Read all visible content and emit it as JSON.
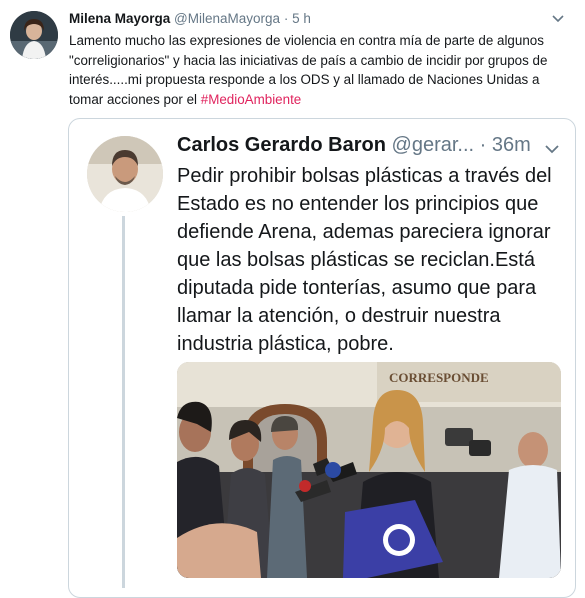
{
  "tweet": {
    "author_name": "Milena Mayorga",
    "author_handle": "@MilenaMayorga",
    "separator": "·",
    "time": "5 h",
    "text_main": "Lamento mucho las expresiones de violencia en contra mía de parte de algunos \"correligionarios\" y hacia las iniciativas de país a cambio de incidir por grupos de interés.....mi propuesta responde a los ODS y al llamado de Naciones Unidas a tomar acciones por el ",
    "hashtag": "#MedioAmbiente"
  },
  "quoted": {
    "author_name": "Carlos Gerardo Baron",
    "author_handle": "@gerar...",
    "separator": "·",
    "time": "36m",
    "text": "Pedir prohibir bolsas plásticas a través del Estado es no entender los principios que defiende Arena, ademas pareciera ignorar que las bolsas plásticas se reciclan.Está diputada pide tonterías, asumo que para llamar la atención, o destruir nuestra industria plástica, pobre.",
    "photo_sign_text": "CORRESPONDE"
  },
  "icons": {
    "menu": "chevron-down-icon"
  },
  "colors": {
    "hashtag": "#e0245e",
    "secondary_text": "#657786",
    "border": "#ccd6dd"
  }
}
